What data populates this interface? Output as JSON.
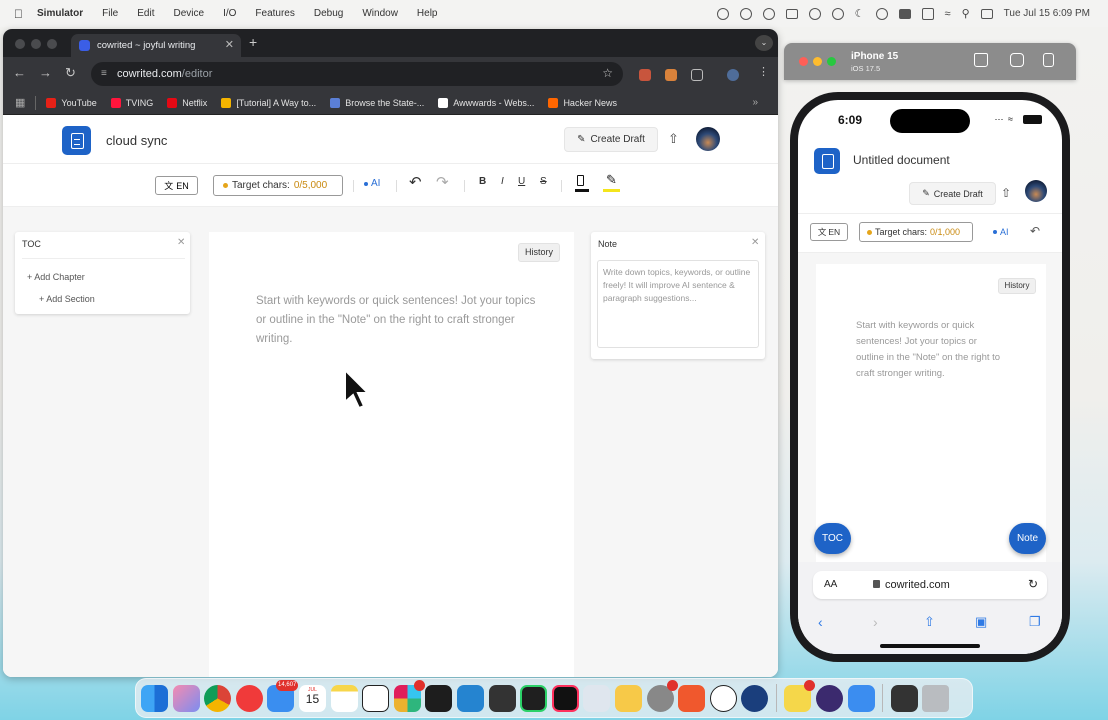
{
  "menubar": {
    "app": "Simulator",
    "items": [
      "File",
      "Edit",
      "Device",
      "I/O",
      "Features",
      "Debug",
      "Window",
      "Help"
    ],
    "datetime": "Tue Jul 15  6:09 PM"
  },
  "browser": {
    "tab_title": "cowrited ~ joyful writing",
    "url_host": "cowrited.com",
    "url_path": "/editor",
    "bookmarks": [
      {
        "label": "YouTube",
        "color": "#e62117"
      },
      {
        "label": "TVING",
        "color": "#ff153c"
      },
      {
        "label": "Netflix",
        "color": "#e50914"
      },
      {
        "label": "[Tutorial] A Way to...",
        "color": "#f4b400"
      },
      {
        "label": "Browse the State-...",
        "color": "#5b7fd6"
      },
      {
        "label": "Awwwards - Webs...",
        "color": "#ffffff"
      },
      {
        "label": "Hacker News",
        "color": "#ff6600"
      }
    ]
  },
  "editor": {
    "doc_title": "cloud sync",
    "create_draft": "Create Draft",
    "lang": "EN",
    "target_label": "Target chars:",
    "target_value": "0/5,000",
    "ai_label": "AI",
    "format": {
      "bold": "B",
      "italic": "I",
      "underline": "U",
      "strike": "S"
    },
    "toc": {
      "title": "TOC",
      "add_chapter": "+ Add Chapter",
      "add_section": "+ Add Section"
    },
    "history": "History",
    "placeholder": "Start with keywords or quick sentences! Jot your topics or outline in the \"Note\" on the right to craft stronger writing.",
    "note": {
      "title": "Note",
      "placeholder": "Write down topics, keywords, or outline freely! It will improve AI sentence & paragraph suggestions..."
    }
  },
  "simulator": {
    "device": "iPhone 15",
    "os": "iOS 17.5"
  },
  "phone": {
    "time": "6:09",
    "doc_title": "Untitled document",
    "create_draft": "Create Draft",
    "lang": "EN",
    "target_label": "Target chars:",
    "target_value": "0/1,000",
    "ai_label": "AI",
    "history": "History",
    "placeholder": "Start with keywords or quick sentences! Jot your topics or outline in the \"Note\" on the right to craft stronger writing.",
    "toc_button": "TOC",
    "note_button": "Note",
    "text_size": "AA",
    "url": "cowrited.com"
  },
  "dock": {
    "mail_badge": "14,607",
    "calendar_month": "JUL",
    "calendar_day": "15",
    "colors": {
      "accent": "#1e63c7",
      "target_value": "#c98a10"
    }
  }
}
